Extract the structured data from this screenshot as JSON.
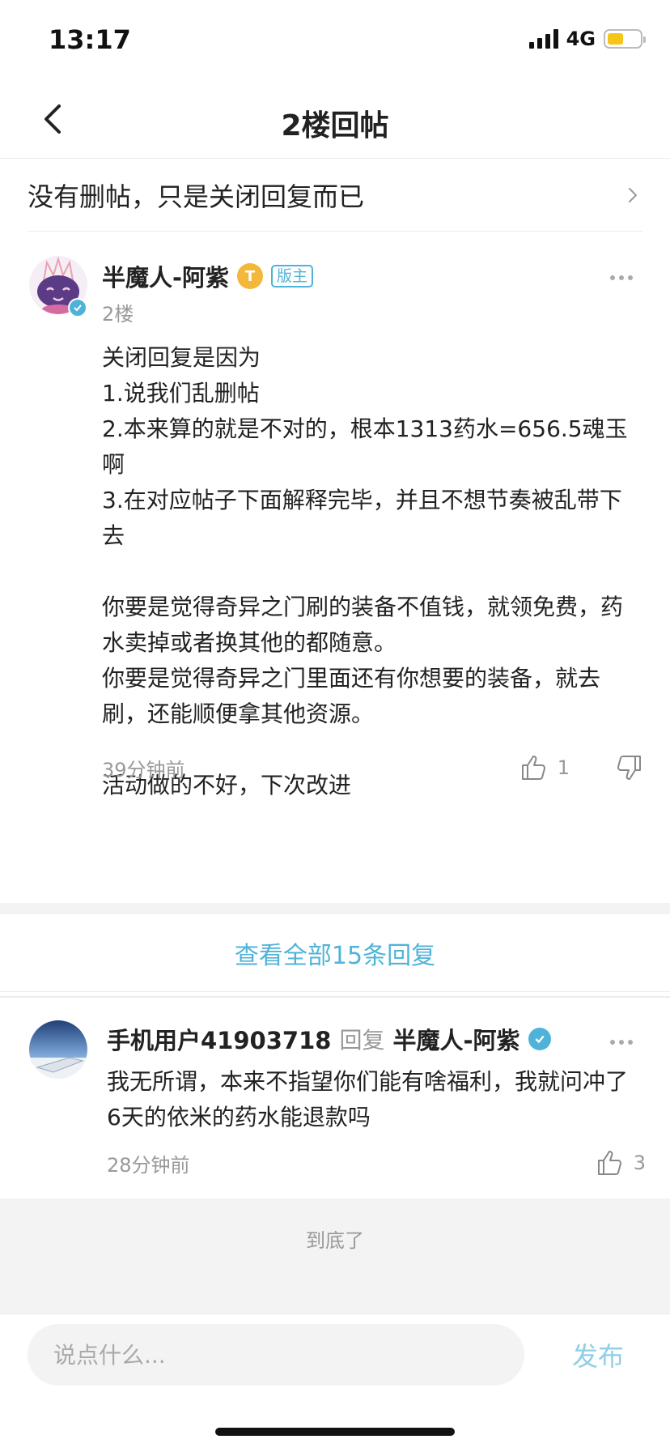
{
  "status_bar": {
    "time": "13:17",
    "network": "4G",
    "battery_level": 0.5,
    "battery_color": "#f5c518"
  },
  "header": {
    "title": "2楼回帖",
    "back_icon": "chevron-left-icon"
  },
  "thread": {
    "title": "没有删帖，只是关闭回复而已",
    "chevron_icon": "chevron-right-icon"
  },
  "post": {
    "author": "半魔人-阿紫",
    "level_badge": "T",
    "role_badge": "版主",
    "floor": "2楼",
    "content_lines": [
      "关闭回复是因为",
      "1.说我们乱删帖",
      "2.本来算的就是不对的，根本1313药水=656.5魂玉啊",
      "3.在对应帖子下面解释完毕，并且不想节奏被乱带下去",
      "",
      "你要是觉得奇异之门刷的装备不值钱，就领免费，药水卖掉或者换其他的都随意。",
      "你要是觉得奇异之门里面还有你想要的装备，就去刷，还能顺便拿其他资源。",
      "",
      "活动做的不好，下次改进"
    ],
    "time": "39分钟前",
    "likes": "1"
  },
  "view_all": "查看全部15条回复",
  "reply": {
    "user": "手机用户41903718",
    "reply_word": "回复",
    "target": "半魔人-阿紫",
    "content": "我无所谓，本来不指望你们能有啥福利，我就问冲了6天的依米的药水能退款吗",
    "time": "28分钟前",
    "likes": "3"
  },
  "end_text": "到底了",
  "composer": {
    "placeholder": "说点什么...",
    "publish": "发布"
  },
  "colors": {
    "accent": "#4fb3d9",
    "publish_disabled": "#8fcfe6",
    "level_badge": "#f3b73a"
  }
}
